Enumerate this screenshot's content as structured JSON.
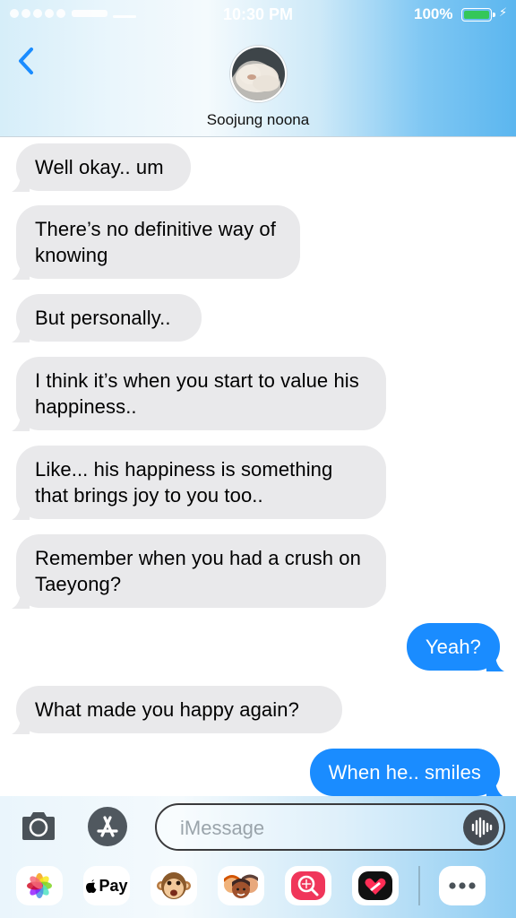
{
  "status_bar": {
    "time": "10:30 PM",
    "battery_percent": "100%"
  },
  "header": {
    "contact_name": "Soojung noona"
  },
  "messages": [
    {
      "side": "in",
      "text": "Well okay.. um"
    },
    {
      "side": "in",
      "text": "There’s no definitive way of knowing"
    },
    {
      "side": "in",
      "text": "But personally.."
    },
    {
      "side": "in",
      "text": "I think it’s when you start to value his happiness.."
    },
    {
      "side": "in",
      "text": "Like... his happiness is something that brings joy to you too.."
    },
    {
      "side": "in",
      "text": "Remember when you had a crush on Taeyong?"
    },
    {
      "side": "out",
      "text": "Yeah?"
    },
    {
      "side": "in",
      "text": "What made you happy again?"
    },
    {
      "side": "out",
      "text": "When he.. smiles"
    }
  ],
  "composer": {
    "placeholder": "iMessage"
  },
  "app_tray": {
    "apple_pay_label": "Pay"
  },
  "colors": {
    "incoming": "#e9e9eb",
    "outgoing": "#1a8cff",
    "accent": "#1a8cff"
  }
}
